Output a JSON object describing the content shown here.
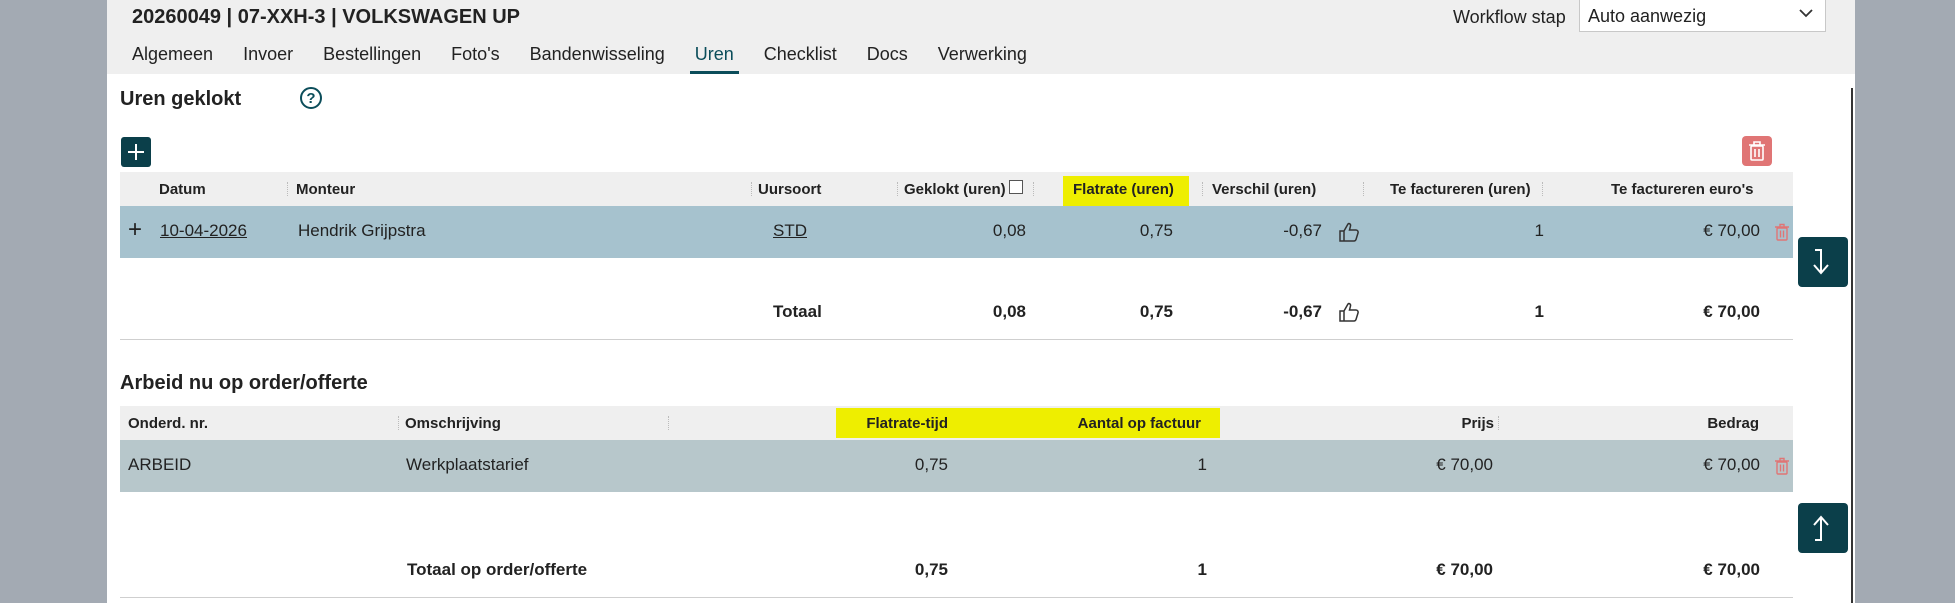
{
  "header": {
    "title": "20260049 | 07-XXH-3 | VOLKSWAGEN UP",
    "workflow_label": "Workflow stap",
    "workflow_value": "Auto aanwezig"
  },
  "tabs": [
    {
      "label": "Algemeen"
    },
    {
      "label": "Invoer"
    },
    {
      "label": "Bestellingen"
    },
    {
      "label": "Foto's"
    },
    {
      "label": "Bandenwisseling"
    },
    {
      "label": "Uren"
    },
    {
      "label": "Checklist"
    },
    {
      "label": "Docs"
    },
    {
      "label": "Verwerking"
    }
  ],
  "hours": {
    "title": "Uren geklokt",
    "help": "?",
    "columns": {
      "datum": "Datum",
      "monteur": "Monteur",
      "uursoort": "Uursoort",
      "geklokt": "Geklokt (uren)",
      "flatrate": "Flatrate (uren)",
      "verschil": "Verschil (uren)",
      "te_factureren_uren": "Te factureren (uren)",
      "te_factureren_euros": "Te factureren euro's"
    },
    "rows": [
      {
        "expand": "+",
        "datum": "10-04-2026",
        "monteur": "Hendrik Grijpstra",
        "uursoort": "STD",
        "geklokt": "0,08",
        "flatrate": "0,75",
        "verschil": "-0,67",
        "te_factureren_uren": "1",
        "te_factureren_euros": "€ 70,00"
      }
    ],
    "total": {
      "label": "Totaal",
      "geklokt": "0,08",
      "flatrate": "0,75",
      "verschil": "-0,67",
      "te_factureren_uren": "1",
      "te_factureren_euros": "€ 70,00"
    }
  },
  "labor": {
    "title": "Arbeid nu op order/offerte",
    "columns": {
      "onderd_nr": "Onderd. nr.",
      "omschrijving": "Omschrijving",
      "flatrate_tijd": "Flatrate-tijd",
      "aantal": "Aantal op factuur",
      "prijs": "Prijs",
      "bedrag": "Bedrag"
    },
    "rows": [
      {
        "onderd_nr": "ARBEID",
        "omschrijving": "Werkplaatstarief",
        "flatrate_tijd": "0,75",
        "aantal": "1",
        "prijs": "€ 70,00",
        "bedrag": "€ 70,00"
      }
    ],
    "total": {
      "label": "Totaal op order/offerte",
      "flatrate_tijd": "0,75",
      "aantal": "1",
      "prijs": "€ 70,00",
      "bedrag": "€ 70,00"
    }
  },
  "colors": {
    "accent": "#0b3f4a",
    "highlight": "#eeee00",
    "row_hours": "#a6c2ce",
    "row_labor": "#b7c7cb",
    "delete": "#e07575"
  }
}
